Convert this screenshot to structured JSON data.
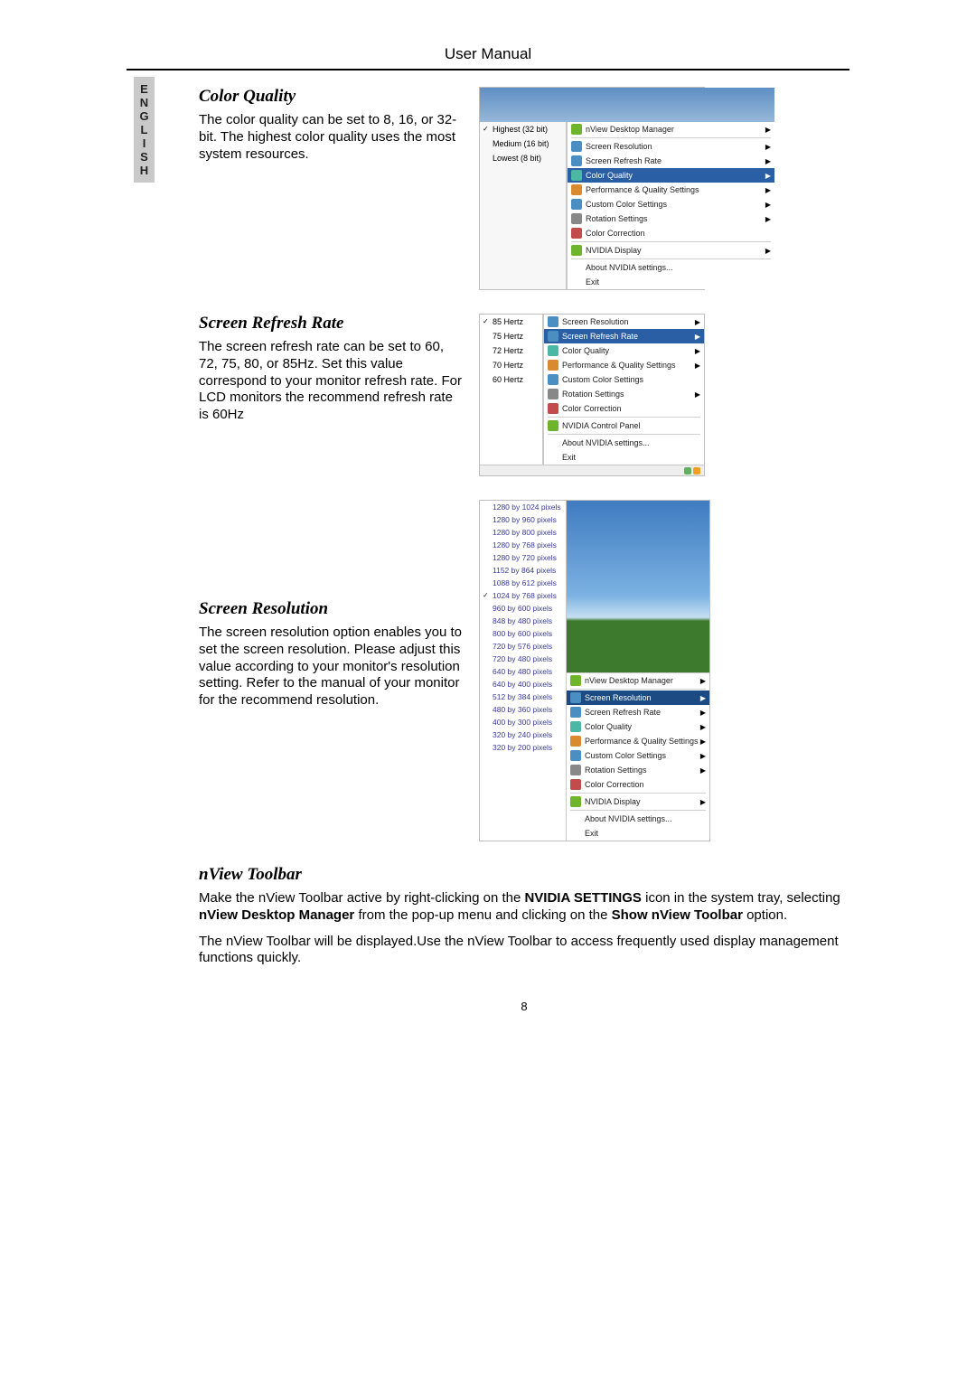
{
  "header": "User Manual",
  "language_tab": "ENGLISH",
  "page_number": "8",
  "sections": {
    "color_quality": {
      "title": "Color Quality",
      "body": "The color quality can be set to 8, 16, or 32-bit. The highest color quality uses the most system resources."
    },
    "refresh_rate": {
      "title": "Screen Refresh Rate",
      "body": "The screen refresh rate can be set to 60, 72, 75, 80, or 85Hz. Set this value correspond to your monitor refresh rate. For LCD monitors the recommend refresh rate is 60Hz"
    },
    "resolution": {
      "title": "Screen Resolution",
      "body": "The screen resolution option enables you to set the screen resolution. Please adjust this value according to your monitor's resolution setting. Refer to the manual of your monitor for the recommend resolution."
    },
    "toolbar": {
      "title": "nView Toolbar",
      "body_pre": "Make the nView Toolbar active by right-clicking on the ",
      "bold1": "NVIDIA SETTINGS",
      "body_mid1": " icon in the system tray, selecting ",
      "bold2": "nView Desktop Manager",
      "body_mid2": " from the pop-up menu and clicking on the ",
      "bold3": "Show nView Toolbar",
      "body_end": " option.",
      "body2": "The nView Toolbar will be displayed.Use the nView Toolbar to access frequently used display management functions quickly."
    }
  },
  "menus": {
    "common": {
      "nview_desktop_mgr": "nView Desktop Manager",
      "screen_resolution": "Screen Resolution",
      "screen_refresh_rate": "Screen Refresh Rate",
      "color_quality": "Color Quality",
      "perf_quality": "Performance & Quality Settings",
      "custom_color": "Custom Color Settings",
      "rotation": "Rotation Settings",
      "color_correction": "Color Correction",
      "nvidia_display": "NVIDIA Display",
      "nvidia_control_panel": "NVIDIA Control Panel",
      "about": "About NVIDIA settings...",
      "exit": "Exit"
    },
    "color_quality_options": [
      {
        "label": "Highest (32 bit)",
        "checked": true
      },
      {
        "label": "Medium (16 bit)",
        "checked": false
      },
      {
        "label": "Lowest (8 bit)",
        "checked": false
      }
    ],
    "refresh_rate_options": [
      {
        "label": "85 Hertz",
        "checked": true
      },
      {
        "label": "75 Hertz",
        "checked": false
      },
      {
        "label": "72 Hertz",
        "checked": false
      },
      {
        "label": "70 Hertz",
        "checked": false
      },
      {
        "label": "60 Hertz",
        "checked": false
      }
    ],
    "resolution_options": [
      "1280 by 1024 pixels",
      "1280 by 960 pixels",
      "1280 by 800 pixels",
      "1280 by 768 pixels",
      "1280 by 720 pixels",
      "1152 by 864 pixels",
      "1088 by 612 pixels",
      "1024 by 768 pixels",
      "960 by 600 pixels",
      "848 by 480 pixels",
      "800 by 600 pixels",
      "720 by 576 pixels",
      "720 by 480 pixels",
      "640 by 480 pixels",
      "640 by 400 pixels",
      "512 by 384 pixels",
      "480 by 360 pixels",
      "400 by 300 pixels",
      "320 by 240 pixels",
      "320 by 200 pixels"
    ],
    "resolution_checked_index": 7
  }
}
